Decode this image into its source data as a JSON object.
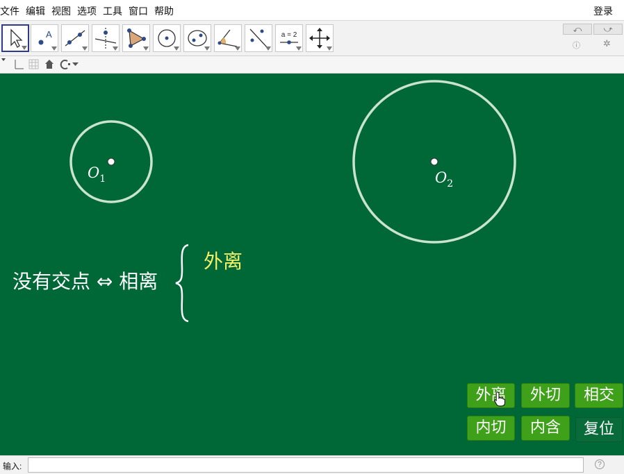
{
  "menu": {
    "items": [
      "文件",
      "编辑",
      "视图",
      "选项",
      "工具",
      "窗口",
      "帮助"
    ],
    "login": "登录"
  },
  "toolbar": {
    "tools": [
      {
        "name": "move-tool",
        "icon": "arrow-icon",
        "selected": true
      },
      {
        "name": "point-tool",
        "icon": "point-icon",
        "label": "A"
      },
      {
        "name": "line-tool",
        "icon": "line-icon"
      },
      {
        "name": "perpendicular-tool",
        "icon": "perpendicular-icon"
      },
      {
        "name": "polygon-tool",
        "icon": "polygon-icon"
      },
      {
        "name": "circle-tool",
        "icon": "circle-center-point-icon"
      },
      {
        "name": "conic-tool",
        "icon": "ellipse-icon"
      },
      {
        "name": "angle-tool",
        "icon": "angle-icon"
      },
      {
        "name": "reflect-tool",
        "icon": "reflect-line-icon"
      },
      {
        "name": "slider-tool",
        "icon": "slider-icon",
        "label": "a = 2"
      },
      {
        "name": "move-view-tool",
        "icon": "move-graphics-icon"
      }
    ],
    "undo_icon": "undo-icon",
    "redo_icon": "redo-icon",
    "help_icon": "help-icon",
    "settings_icon": "gear-icon"
  },
  "canvas": {
    "background": "#006837",
    "circle1_label": "O",
    "circle1_sub": "1",
    "circle2_label": "O",
    "circle2_sub": "2",
    "statement": "没有交点 ⇔ 相离",
    "case_label": "外离",
    "case_color": "#f3f06a"
  },
  "buttons": {
    "external_separate": "外离",
    "external_tangent": "外切",
    "intersect": "相交",
    "internal_tangent": "内切",
    "contain": "内含",
    "reset": "复位"
  },
  "input_bar": {
    "label": "输入:",
    "value": ""
  }
}
